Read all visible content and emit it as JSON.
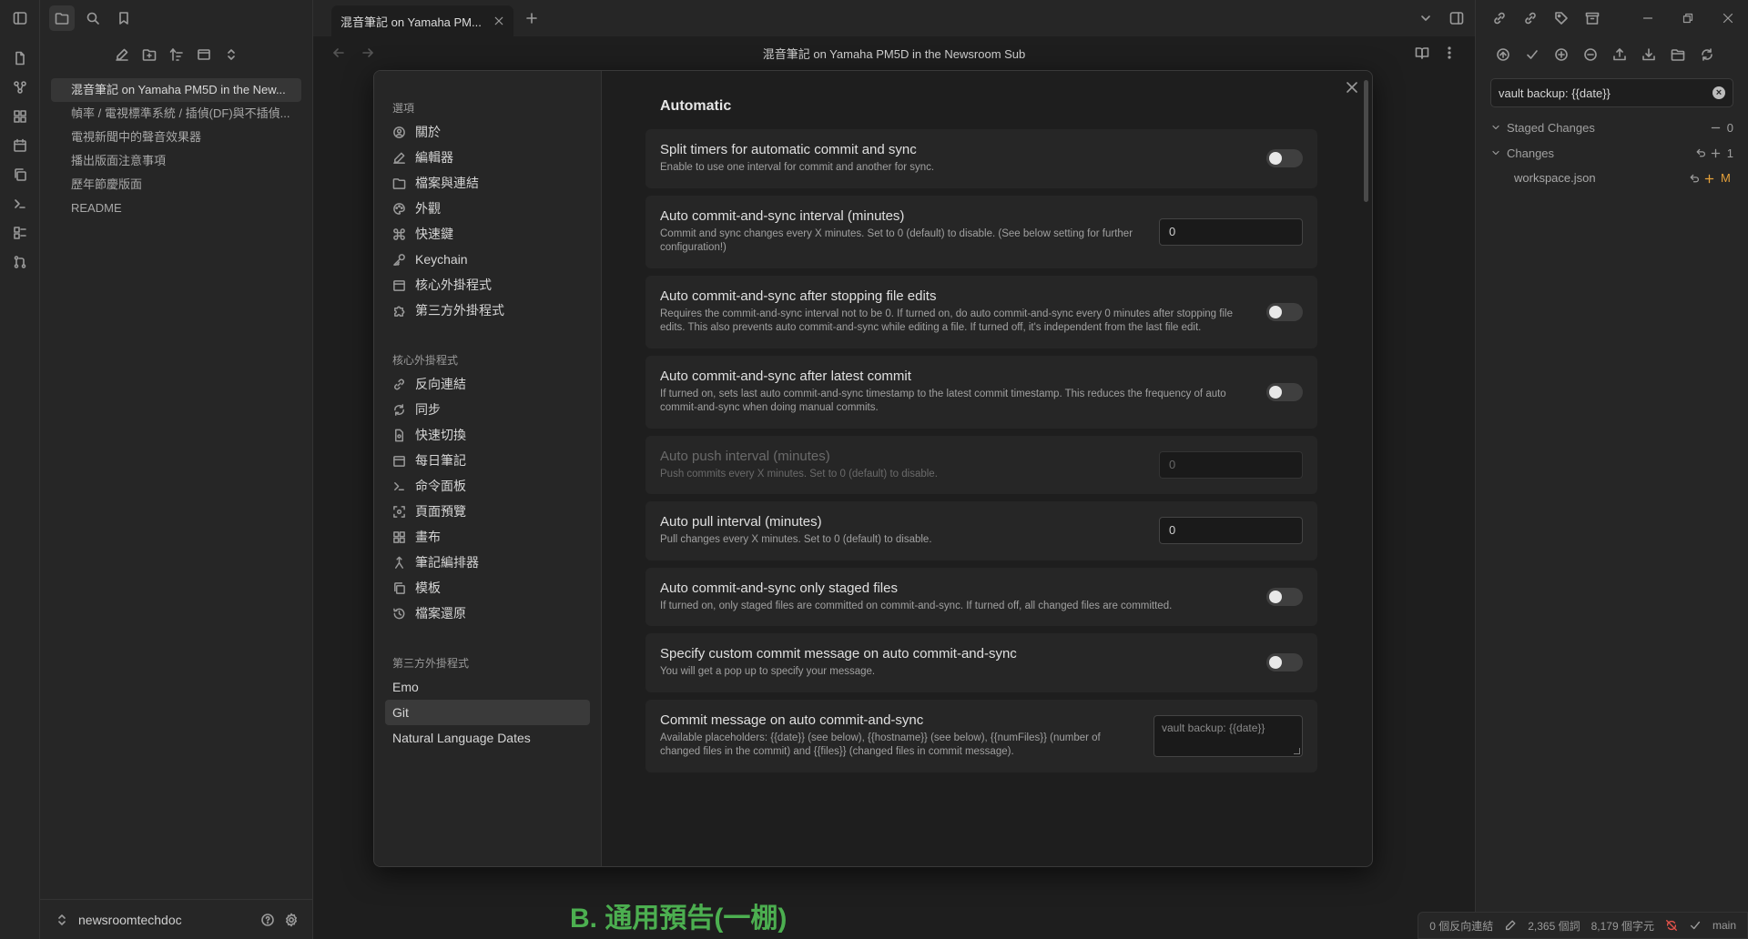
{
  "app": {
    "tab_title": "混音筆記 on Yamaha PM...",
    "view_title": "混音筆記 on Yamaha PM5D in the Newsroom Sub",
    "doc_heading": "B. 通用預告(一棚)"
  },
  "files": [
    "混音筆記 on Yamaha PM5D in the New...",
    "幀率 / 電視標準系統 / 插偵(DF)與不插偵...",
    "電視新聞中的聲音效果器",
    "播出版面注意事項",
    "歷年節慶版面",
    "README"
  ],
  "vault": {
    "name": "newsroomtechdoc"
  },
  "modal": {
    "options_header": "選項",
    "options": [
      "關於",
      "編輯器",
      "檔案與連結",
      "外觀",
      "快速鍵",
      "Keychain",
      "核心外掛程式",
      "第三方外掛程式"
    ],
    "core_header": "核心外掛程式",
    "core": [
      "反向連結",
      "同步",
      "快速切換",
      "每日筆記",
      "命令面板",
      "頁面預覽",
      "畫布",
      "筆記編排器",
      "模板",
      "檔案還原"
    ],
    "community_header": "第三方外掛程式",
    "community": [
      "Emo",
      "Git",
      "Natural Language Dates"
    ],
    "section_title": "Automatic",
    "settings": [
      {
        "name": "Split timers for automatic commit and sync",
        "desc": "Enable to use one interval for commit and another for sync.",
        "control": "toggle"
      },
      {
        "name": "Auto commit-and-sync interval (minutes)",
        "desc": "Commit and sync changes every X minutes. Set to 0 (default) to disable. (See below setting for further configuration!)",
        "control": "input",
        "value": "0"
      },
      {
        "name": "Auto commit-and-sync after stopping file edits",
        "desc": "Requires the commit-and-sync interval not to be 0. If turned on, do auto commit-and-sync every 0 minutes after stopping file edits. This also prevents auto commit-and-sync while editing a file. If turned off, it's independent from the last file edit.",
        "control": "toggle"
      },
      {
        "name": "Auto commit-and-sync after latest commit",
        "desc": "If turned on, sets last auto commit-and-sync timestamp to the latest commit timestamp. This reduces the frequency of auto commit-and-sync when doing manual commits.",
        "control": "toggle"
      },
      {
        "name": "Auto push interval (minutes)",
        "desc": "Push commits every X minutes. Set to 0 (default) to disable.",
        "control": "input",
        "value": "0",
        "dim": true
      },
      {
        "name": "Auto pull interval (minutes)",
        "desc": "Pull changes every X minutes. Set to 0 (default) to disable.",
        "control": "input",
        "value": "0"
      },
      {
        "name": "Auto commit-and-sync only staged files",
        "desc": "If turned on, only staged files are committed on commit-and-sync. If turned off, all changed files are committed.",
        "control": "toggle"
      },
      {
        "name": "Specify custom commit message on auto commit-and-sync",
        "desc": "You will get a pop up to specify your message.",
        "control": "toggle"
      },
      {
        "name": "Commit message on auto commit-and-sync",
        "desc": "Available placeholders: {{date}} (see below), {{hostname}} (see below), {{numFiles}} (number of changed files in the commit) and {{files}} (changed files in commit message).",
        "control": "textarea",
        "placeholder": "vault backup: {{date}}"
      }
    ]
  },
  "git": {
    "commit_message": "vault backup: {{date}}",
    "staged_label": "Staged Changes",
    "staged_count": "0",
    "changes_label": "Changes",
    "changes_count": "1",
    "changed_file": "workspace.json",
    "changed_status": "M"
  },
  "status": {
    "backlinks": "0 個反向連結",
    "words": "2,365 個詞",
    "chars": "8,179 個字元",
    "branch": "main"
  }
}
